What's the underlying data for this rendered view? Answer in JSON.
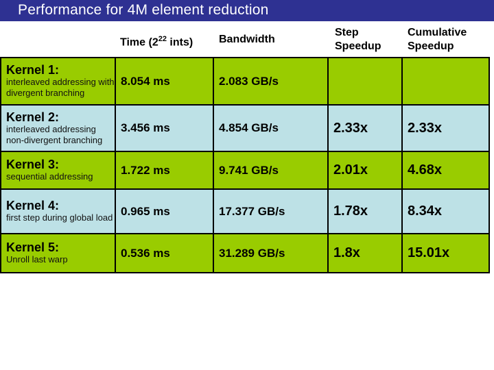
{
  "title": "Performance for 4M element reduction",
  "headers": {
    "time_prefix": "Time (2",
    "time_exp": "22",
    "time_suffix": " ints)",
    "bandwidth": "Bandwidth",
    "step_speedup_1": "Step",
    "step_speedup_2": "Speedup",
    "cumulative_speedup_1": "Cumulative",
    "cumulative_speedup_2": "Speedup"
  },
  "colors": {
    "title_bar": "#2e3192",
    "row_green": "#99cc00",
    "row_blue": "#bde1e6"
  },
  "rows": [
    {
      "kernel": "Kernel 1:",
      "desc": "interleaved addressing with divergent branching",
      "time": "8.054 ms",
      "bandwidth": "2.083 GB/s",
      "step": "",
      "cumulative": ""
    },
    {
      "kernel": "Kernel 2:",
      "desc": "interleaved addressing non-divergent branching",
      "time": "3.456 ms",
      "bandwidth": "4.854 GB/s",
      "step": "2.33x",
      "cumulative": "2.33x"
    },
    {
      "kernel": "Kernel 3:",
      "desc": "sequential addressing",
      "time": "1.722 ms",
      "bandwidth": "9.741 GB/s",
      "step": "2.01x",
      "cumulative": "4.68x"
    },
    {
      "kernel": "Kernel 4:",
      "desc": "first step during global load",
      "time": "0.965 ms",
      "bandwidth": "17.377 GB/s",
      "step": "1.78x",
      "cumulative": "8.34x"
    },
    {
      "kernel": "Kernel 5:",
      "desc": "Unroll last warp",
      "time": "0.536 ms",
      "bandwidth": "31.289 GB/s",
      "step": "1.8x",
      "cumulative": "15.01x"
    }
  ]
}
